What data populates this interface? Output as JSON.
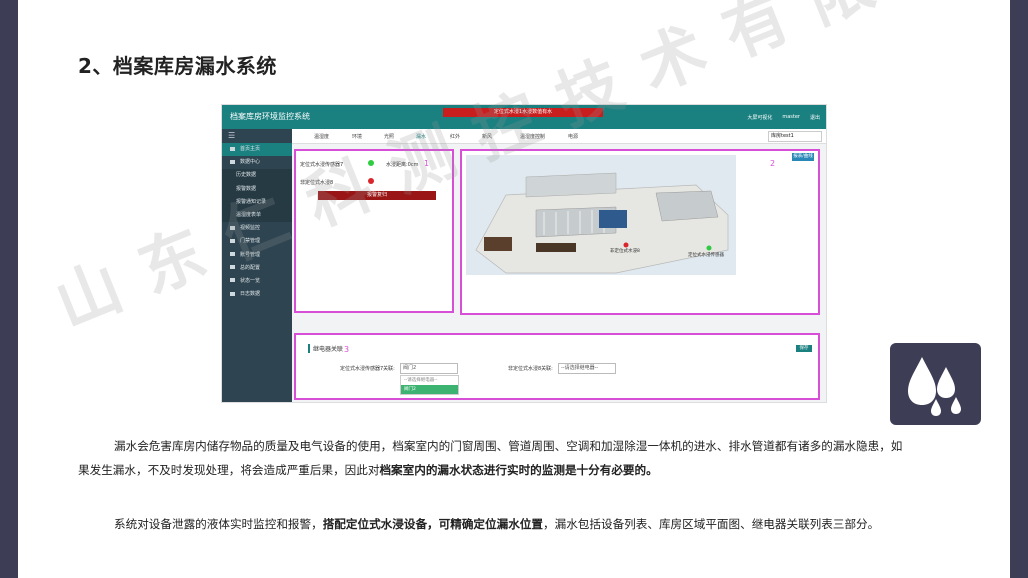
{
  "slide": {
    "title": "2、档案库房漏水系统",
    "watermark": "山东仁科测控技术有限公司",
    "paragraph1": {
      "part1": "漏水会危害库房内储存物品的质量及电气设备的使用，档案室内的门窗周围、管道周围、空调和加湿除湿一体机的进水、排水管道都有诸多的漏水隐患，如",
      "part2": "果发生漏水，不及时发现处理，将会造成严重后果，因此对",
      "bold": "档案室内的漏水状态进行实时的监测是十分有必要的。"
    },
    "paragraph2": {
      "part1": "系统对设备泄露的液体实时监控和报警，",
      "bold": "搭配定位式水浸设备，可精确定位漏水位置",
      "part2": "，漏水包括设备列表、库房区域平面图、继电器关联列表三部分。"
    }
  },
  "app": {
    "title": "档案库房环境监控系统",
    "alert": "定位式水浸1水浸数值有水",
    "header_right": [
      "大屏可视化",
      "master",
      "退出"
    ],
    "sidebar": [
      {
        "label": "首页主页",
        "active": true,
        "sub": false
      },
      {
        "label": "数据中心",
        "active": false,
        "sub": false
      },
      {
        "label": "历史数据",
        "active": false,
        "sub": true
      },
      {
        "label": "报警数据",
        "active": false,
        "sub": true
      },
      {
        "label": "报警通知记录",
        "active": false,
        "sub": true
      },
      {
        "label": "温湿度表单",
        "active": false,
        "sub": true
      },
      {
        "label": "视频监控",
        "active": false,
        "sub": false
      },
      {
        "label": "门禁管理",
        "active": false,
        "sub": false
      },
      {
        "label": "账号管理",
        "active": false,
        "sub": false
      },
      {
        "label": "总的配置",
        "active": false,
        "sub": false
      },
      {
        "label": "状态一览",
        "active": false,
        "sub": false
      },
      {
        "label": "日志数据",
        "active": false,
        "sub": false
      }
    ],
    "tabs": [
      "温湿度",
      "环境",
      "光照",
      "漏水",
      "红外",
      "新风",
      "温湿度控制",
      "电源"
    ],
    "active_tab": "漏水",
    "tab_select": "库房test1",
    "panel1": {
      "num": "1",
      "sensor1_label": "定位式水浸传感器7",
      "sensor1_status_color": "#2ecc40",
      "sensor1_distance": "水浸距离:0cm",
      "sensor2_label": "非定位式水浸8",
      "sensor2_status_color": "#d9262b",
      "alarm_button": "报警复归"
    },
    "panel2": {
      "num": "2",
      "history_button": "报表/曲线",
      "map_label1": "非定位式水浸8",
      "map_label2": "定位式水浸传感器"
    },
    "panel3": {
      "num": "3",
      "section_title": "继电器关联",
      "save_button": "保存",
      "field1_label": "定位式水浸传感器7关联:",
      "field1_value": "阀门2",
      "field2_label": "非定位式水浸8关联:",
      "field2_value": "--请选择继电器--",
      "dropdown": [
        "--请选择继电器--",
        "阀门2"
      ]
    }
  }
}
